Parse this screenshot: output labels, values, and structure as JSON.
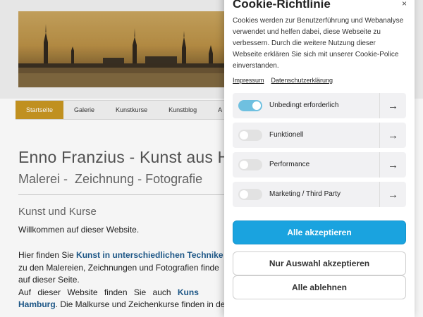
{
  "nav": {
    "items": [
      {
        "label": "Startseite",
        "active": true
      },
      {
        "label": "Galerie",
        "active": false
      },
      {
        "label": "Kunstkurse",
        "active": false
      },
      {
        "label": "Kunstblog",
        "active": false
      },
      {
        "label": "A",
        "active": false
      }
    ]
  },
  "main": {
    "title": "Enno Franzius - Kunst aus H",
    "subtitle": "Malerei -  Zeichnung - Fotografie",
    "section_title": "Kunst und Kurse",
    "welcome": "Willkommen auf dieser Website.",
    "para1_prefix": "Hier finden Sie ",
    "para1_link": "Kunst in unterschiedlichen Technike",
    "para1_line2": "zu den Malereien, Zeichnungen und Fotografien finde",
    "para1_line3": "auf dieser Seite.",
    "para2_prefix": "Auf dieser Website finden Sie auch ",
    "para2_link1": "Kuns",
    "para2_link2": "Hamburg",
    "para2_rest": ". Die Malkurse und Zeichenkurse finden in de"
  },
  "cookie": {
    "title": "Cookie-Richtlinie",
    "close": "×",
    "text": "Cookies werden zur Benutzerführung und Webanalyse verwendet und helfen dabei, diese Webseite zu verbessern. Durch die weitere Nutzung dieser Webseite erklären Sie sich mit unserer Cookie-Police einverstanden.",
    "links": {
      "impressum": "Impressum",
      "datenschutz": "Datenschutzerklärung"
    },
    "categories": [
      {
        "label": "Unbedingt erforderlich",
        "enabled": true
      },
      {
        "label": "Funktionell",
        "enabled": false
      },
      {
        "label": "Performance",
        "enabled": false
      },
      {
        "label": "Marketing / Third Party",
        "enabled": false
      }
    ],
    "arrow_icon": "→",
    "buttons": {
      "accept_all": "Alle akzeptieren",
      "accept_selection": "Nur Auswahl akzeptieren",
      "reject_all": "Alle ablehnen"
    },
    "colors": {
      "primary": "#1aa3df",
      "toggle_on": "#6fc0e0"
    }
  }
}
